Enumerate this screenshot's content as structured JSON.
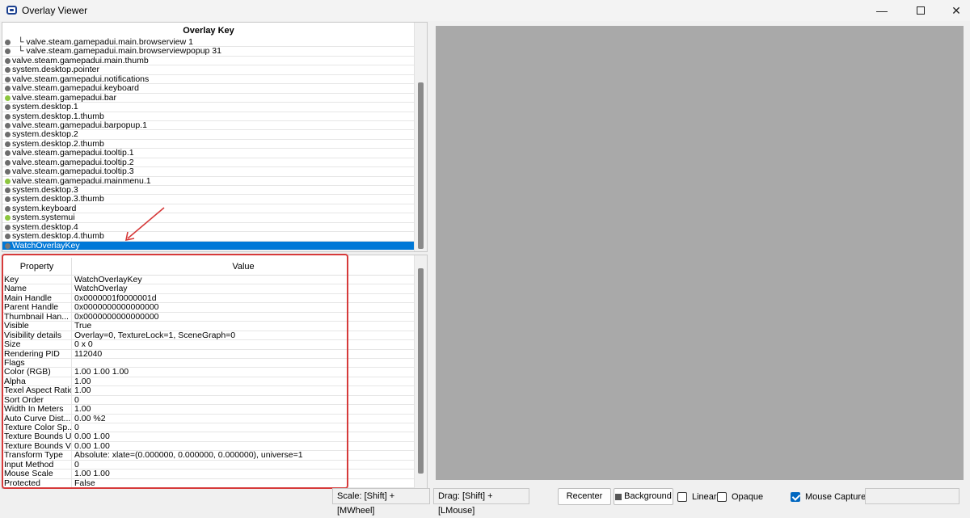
{
  "window": {
    "title": "Overlay Viewer"
  },
  "tree": {
    "header": "Overlay Key",
    "items": [
      {
        "label": "└ valve.steam.gamepadui.main.browserview  1",
        "dot": "gray",
        "child": true
      },
      {
        "label": "└ valve.steam.gamepadui.main.browserviewpopup  31",
        "dot": "gray",
        "child": true
      },
      {
        "label": "valve.steam.gamepadui.main.thumb",
        "dot": "gray"
      },
      {
        "label": "system.desktop.pointer",
        "dot": "gray"
      },
      {
        "label": "valve.steam.gamepadui.notifications",
        "dot": "gray"
      },
      {
        "label": "valve.steam.gamepadui.keyboard",
        "dot": "gray"
      },
      {
        "label": "valve.steam.gamepadui.bar",
        "dot": "green"
      },
      {
        "label": "system.desktop.1",
        "dot": "gray"
      },
      {
        "label": "system.desktop.1.thumb",
        "dot": "gray"
      },
      {
        "label": "valve.steam.gamepadui.barpopup.1",
        "dot": "gray"
      },
      {
        "label": "system.desktop.2",
        "dot": "gray"
      },
      {
        "label": "system.desktop.2.thumb",
        "dot": "gray"
      },
      {
        "label": "valve.steam.gamepadui.tooltip.1",
        "dot": "gray"
      },
      {
        "label": "valve.steam.gamepadui.tooltip.2",
        "dot": "gray"
      },
      {
        "label": "valve.steam.gamepadui.tooltip.3",
        "dot": "gray"
      },
      {
        "label": "valve.steam.gamepadui.mainmenu.1",
        "dot": "green"
      },
      {
        "label": "system.desktop.3",
        "dot": "gray"
      },
      {
        "label": "system.desktop.3.thumb",
        "dot": "gray"
      },
      {
        "label": "system.keyboard",
        "dot": "gray"
      },
      {
        "label": "system.systemui",
        "dot": "green"
      },
      {
        "label": "system.desktop.4",
        "dot": "gray"
      },
      {
        "label": "system.desktop.4.thumb",
        "dot": "gray"
      },
      {
        "label": "WatchOverlayKey",
        "dot": "gray",
        "selected": true
      }
    ]
  },
  "properties": {
    "col_property": "Property",
    "col_value": "Value",
    "rows": [
      {
        "key": "Key",
        "value": "WatchOverlayKey"
      },
      {
        "key": "Name",
        "value": "WatchOverlay"
      },
      {
        "key": "Main Handle",
        "value": "0x0000001f0000001d"
      },
      {
        "key": "Parent Handle",
        "value": "0x0000000000000000"
      },
      {
        "key": "Thumbnail Han...",
        "value": "0x0000000000000000"
      },
      {
        "key": "Visible",
        "value": "True"
      },
      {
        "key": "Visibility details",
        "value": "Overlay=0, TextureLock=1, SceneGraph=0"
      },
      {
        "key": "Size",
        "value": "0 x 0"
      },
      {
        "key": "Rendering PID",
        "value": "112040"
      },
      {
        "key": "Flags",
        "value": ""
      },
      {
        "key": "Color (RGB)",
        "value": " 1.00  1.00  1.00"
      },
      {
        "key": "Alpha",
        "value": " 1.00"
      },
      {
        "key": "Texel Aspect Ratio",
        "value": " 1.00"
      },
      {
        "key": "Sort Order",
        "value": "0"
      },
      {
        "key": "Width In Meters",
        "value": " 1.00"
      },
      {
        "key": "Auto Curve Dist...",
        "value": " 0.00 %2"
      },
      {
        "key": "Texture Color Sp...",
        "value": "0"
      },
      {
        "key": "Texture Bounds U",
        "value": " 0.00  1.00"
      },
      {
        "key": "Texture Bounds V",
        "value": " 0.00  1.00"
      },
      {
        "key": "Transform Type",
        "value": "Absolute: xlate=(0.000000, 0.000000, 0.000000), universe=1"
      },
      {
        "key": "Input Method",
        "value": "0"
      },
      {
        "key": "Mouse Scale",
        "value": " 1.00  1.00"
      },
      {
        "key": "Protected",
        "value": "False"
      }
    ]
  },
  "statusbar": {
    "scale_hint": "Scale: [Shift] + [MWheel]",
    "drag_hint": "Drag: [Shift] + [LMouse]",
    "recenter": "Recenter",
    "background": "Background",
    "linear": "Linear",
    "opaque": "Opaque",
    "mouse_capture": "Mouse Capture",
    "mouse_capture_checked": true,
    "linear_checked": false,
    "opaque_checked": false
  },
  "colors": {
    "selection": "#0078d7",
    "highlight": "#d63a3a",
    "canvas": "#a9a9a9",
    "active_dot": "#8dc63f"
  }
}
